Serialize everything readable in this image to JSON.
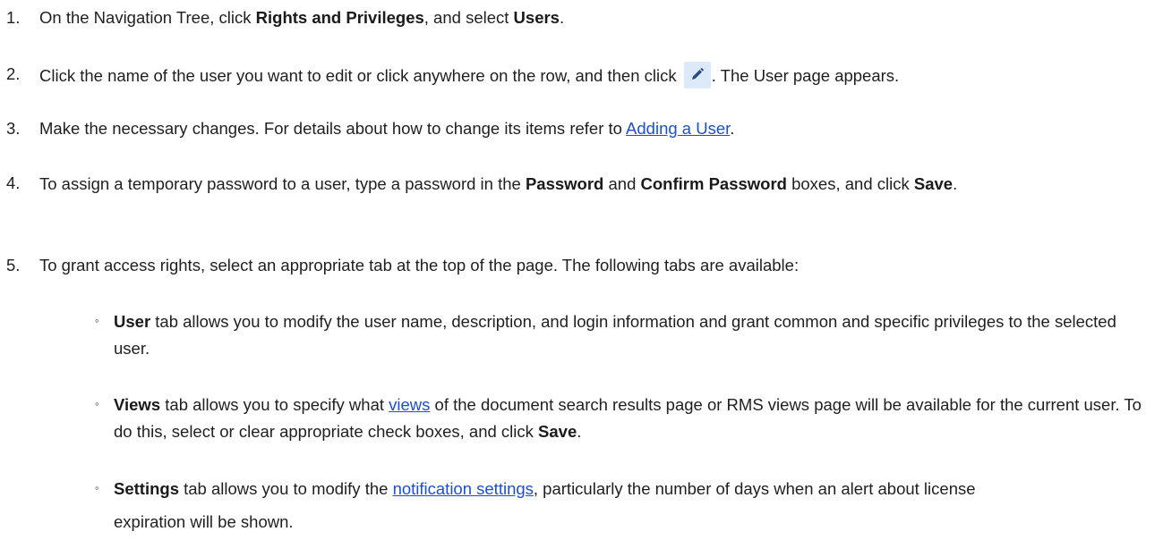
{
  "steps": [
    {
      "number": "1.",
      "t1": "On the Navigation Tree, click ",
      "b1": "Rights and Privileges",
      "t2": ", and select ",
      "b2": "Users",
      "t3": "."
    },
    {
      "number": "2.",
      "t1": "Click the name of the user you want to edit or click anywhere on the row, and then click ",
      "icon": "pencil-edit-icon",
      "t2": ". The User page appears."
    },
    {
      "number": "3.",
      "t1": "Make the necessary changes. For details about how to change its items refer to ",
      "link": "Adding a User",
      "t2": "."
    },
    {
      "number": "4.",
      "t1": "To assign a temporary password to a user, type a password in the ",
      "b1": "Password",
      "t2": " and ",
      "b2": "Confirm Password",
      "t3": " boxes, and click ",
      "b3": "Save",
      "t4": "."
    },
    {
      "number": "5.",
      "t1": "To grant access rights, select an appropriate tab at the top of the page. The following tabs are available:"
    }
  ],
  "tabs": [
    {
      "bullet": "◦",
      "name": "User",
      "t1": " tab allows you to modify the user name, description, and login information and grant common and specific privileges to the selected user."
    },
    {
      "bullet": "◦",
      "name": "Views",
      "t1": " tab allows you to specify what ",
      "link": "views",
      "t2": " of the document search results page or RMS views page will be available for the current user. To do this, select or clear appropriate check boxes, and click ",
      "b1": "Save",
      "t3": "."
    },
    {
      "bullet": "◦",
      "name": "Settings",
      "t1": " tab allows you to modify the ",
      "link": "notification settings",
      "t2": ", particularly the number of days when an alert about license expiration will be shown."
    }
  ],
  "colors": {
    "text": "#1f1f1f",
    "link": "#1a4fd6",
    "icon_bg": "#dbe9f8",
    "icon_fg": "#2b4a86"
  }
}
